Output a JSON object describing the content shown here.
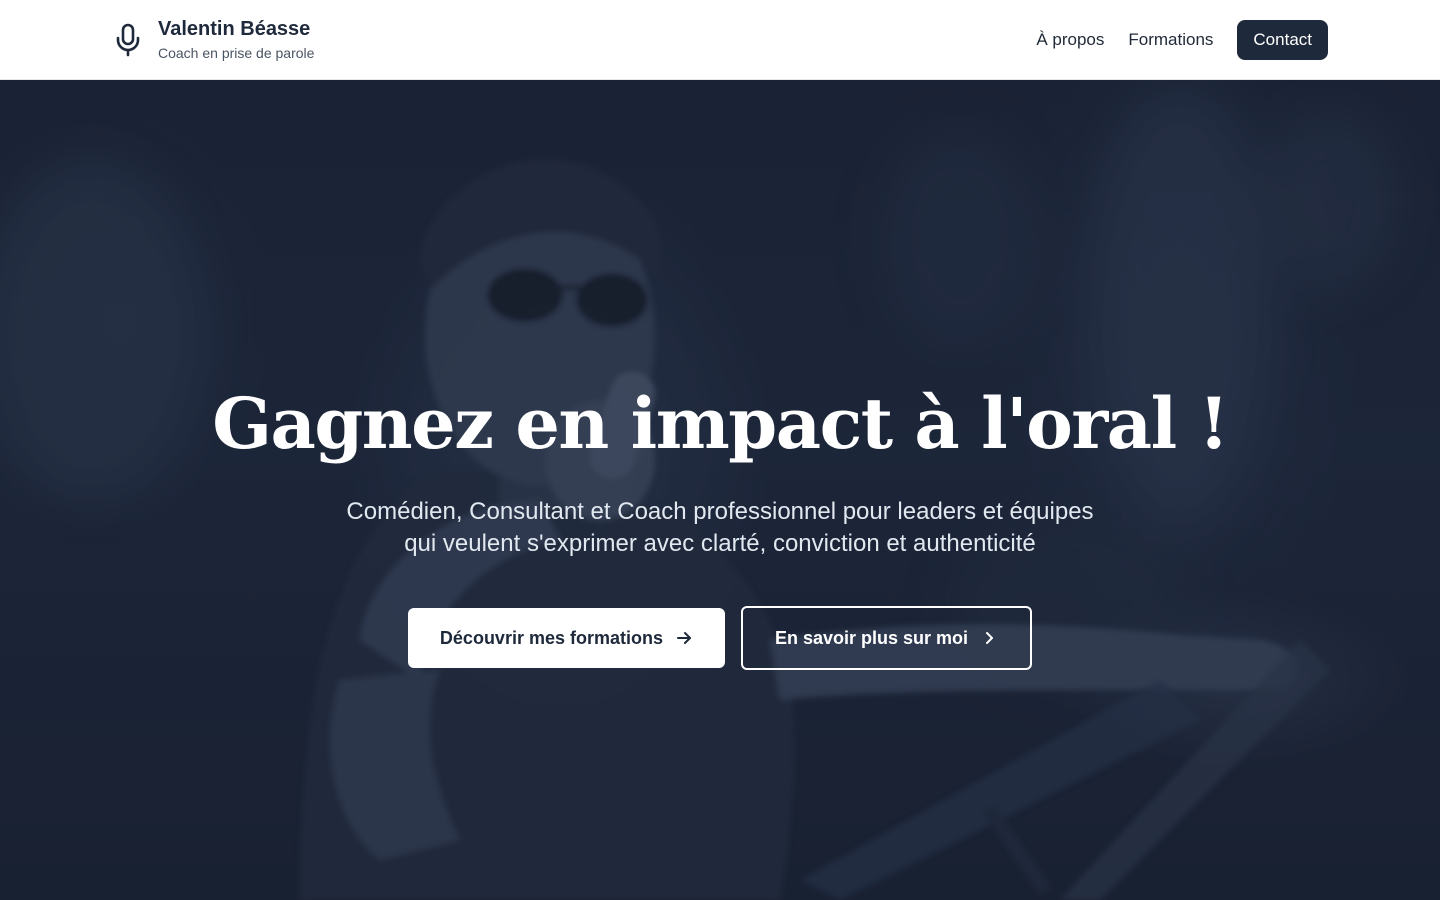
{
  "header": {
    "brand_icon": "microphone-icon",
    "brand_name": "Valentin Béasse",
    "brand_tagline": "Coach en prise de parole",
    "nav": [
      {
        "label": "À propos"
      },
      {
        "label": "Formations"
      }
    ],
    "contact_label": "Contact"
  },
  "hero": {
    "title": "Gagnez en impact à l'oral !",
    "subtitle": "Comédien, Consultant et Coach professionnel pour leaders et équipes qui veulent s'exprimer avec clarté, conviction et authenticité",
    "primary_cta": {
      "label": "Découvrir mes formations",
      "icon": "arrow-right-icon"
    },
    "secondary_cta": {
      "label": "En savoir plus sur moi",
      "icon": "chevron-right-icon"
    },
    "background_image": "speaker-with-microphone-photo"
  },
  "colors": {
    "brand_dark": "#1e293b",
    "hero_overlay": "#1b2436",
    "white": "#ffffff"
  }
}
